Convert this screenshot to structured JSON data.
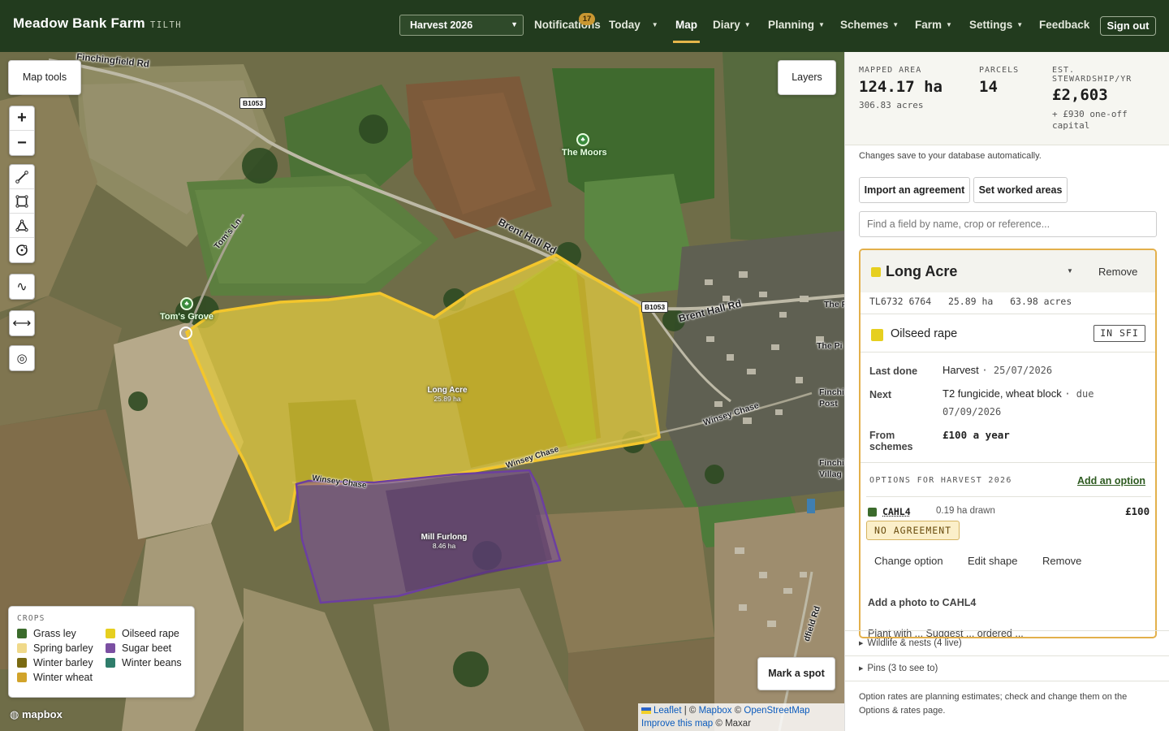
{
  "brand": {
    "name": "Meadow Bank Farm",
    "product": "TILTH"
  },
  "nav": {
    "season": "Harvest 2026",
    "notifications": "Notifications",
    "notifications_count": "17",
    "today": "Today",
    "map": "Map",
    "diary": "Diary",
    "planning": "Planning",
    "schemes": "Schemes",
    "farm": "Farm",
    "settings": "Settings",
    "feedback": "Feedback",
    "signout": "Sign out"
  },
  "map": {
    "tools_label": "Map tools",
    "layers_label": "Layers",
    "zoom_in": "+",
    "zoom_out": "−",
    "mark_spot": "Mark a spot",
    "road_labels": {
      "finchingfield": "Finchingfield Rd",
      "brent_hall_1": "Brent Hall Rd",
      "brent_hall_2": "Brent Hall Rd",
      "toms_ln": "Tom's Ln",
      "winsey_1": "Winsey Chase",
      "winsey_2": "Winsey Chase",
      "winsey_3": "Winsey Chase",
      "b1053_a": "B1053",
      "b1053_b": "B1053",
      "the_p": "The P",
      "the_pi": "The Pi",
      "finchi_post": "Finchi Post",
      "finchi_villag": "Finchi Villag",
      "dfield_rd": "dfield Rd"
    },
    "pois": {
      "the_moors": "The Moors",
      "toms_grove": "Tom's Grove"
    },
    "fields": [
      {
        "name": "Long Acre",
        "area": "25.89 ha"
      },
      {
        "name": "Mill Furlong",
        "area": "8.46 ha"
      }
    ],
    "legend": {
      "title": "CROPS",
      "items": [
        {
          "label": "Grass ley",
          "color": "#3b6b2c"
        },
        {
          "label": "Oilseed rape",
          "color": "#e6cf1f"
        },
        {
          "label": "Spring barley",
          "color": "#f0d98a"
        },
        {
          "label": "Sugar beet",
          "color": "#7b4fa2"
        },
        {
          "label": "Winter barley",
          "color": "#7a6a12"
        },
        {
          "label": "Winter beans",
          "color": "#2f7d6b"
        },
        {
          "label": "Winter wheat",
          "color": "#d1a32a"
        }
      ]
    },
    "mapbox_logo": "mapbox",
    "attribution": {
      "leaflet": "Leaflet",
      "sep1": " | © ",
      "mapbox": "Mapbox",
      "sep2": " © ",
      "osm": "OpenStreetMap",
      "improve": "Improve this map",
      "maxar": " © Maxar"
    }
  },
  "panel": {
    "stats": {
      "mapped_label": "MAPPED AREA",
      "mapped_value": "124.17 ha",
      "mapped_sub": "306.83 acres",
      "parcels_label": "PARCELS",
      "parcels_value": "14",
      "est_label_1": "EST.",
      "est_label_2": "STEWARDSHIP/YR",
      "est_value": "£2,603",
      "est_sub_1": "+ £930 one-off",
      "est_sub_2": "capital"
    },
    "autosave": "Changes save to your database automatically.",
    "import_btn": "Import an agreement",
    "worked_btn": "Set worked areas",
    "search_placeholder": "Find a field by name, crop or reference...",
    "card": {
      "title": "Long Acre",
      "color": "#e6cf1f",
      "remove": "Remove",
      "ref": "TL6732 6764",
      "area_ha": "25.89 ha",
      "area_ac": "63.98 acres",
      "crop": "Oilseed rape",
      "scheme_tag": "IN SFI",
      "last_done_label": "Last done",
      "last_done_value": "Harvest",
      "last_done_date": "25/07/2026",
      "next_label": "Next",
      "next_value": "T2 fungicide, wheat block",
      "next_due": "due",
      "next_date": "07/09/2026",
      "from_label_1": "From",
      "from_label_2": "schemes",
      "from_value": "£100 a year",
      "options_head": "OPTIONS FOR HARVEST 2026",
      "add_option": "Add an option",
      "option": {
        "code": "CAHL4",
        "color": "#3b6b2c",
        "drawn": "0.19 ha drawn",
        "amount": "£100",
        "status": "NO AGREEMENT",
        "change": "Change option",
        "edit": "Edit shape",
        "remove": "Remove"
      },
      "add_photo": "Add a photo to CAHL4",
      "cut_text": "Plant with ... Suggest ... ordered ... "
    },
    "wildlife": "Wildlife & nests (4 live)",
    "pins": "Pins (3 to see to)",
    "footnote": "Option rates are planning estimates; check and change them on the Options & rates page."
  }
}
